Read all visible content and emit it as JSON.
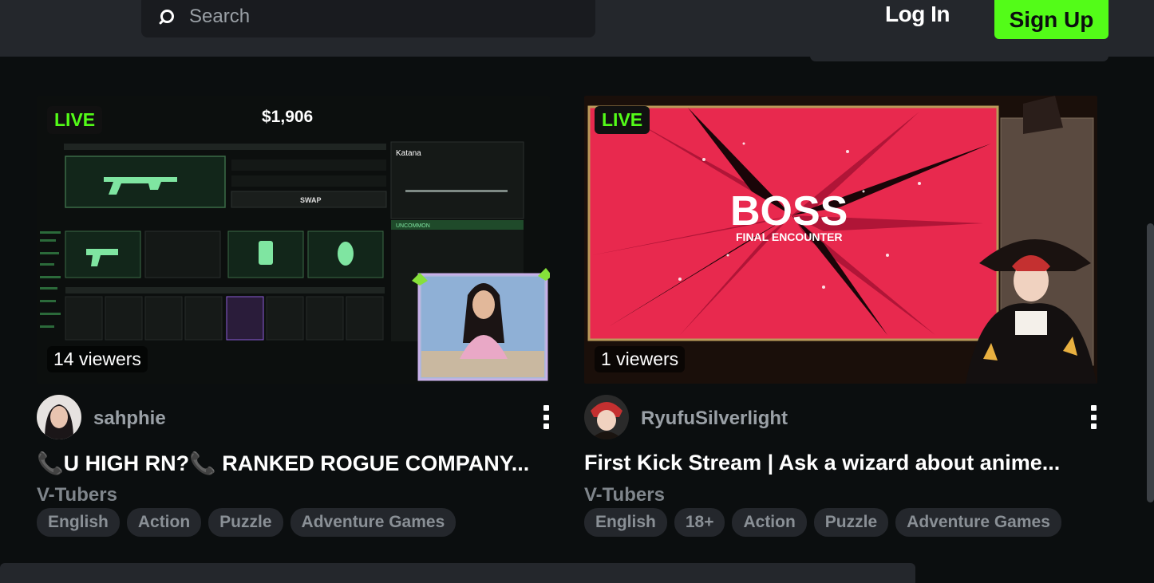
{
  "header": {
    "search_placeholder": "Search",
    "login_label": "Log In",
    "signup_label": "Sign Up",
    "accent_color": "#53fc18"
  },
  "streams": [
    {
      "live_label": "LIVE",
      "viewers": "14 viewers",
      "channel": "sahphie",
      "title": "📞U HIGH RN?📞 RANKED ROGUE COMPANY...",
      "category": "V-Tubers",
      "tags": [
        "English",
        "Action",
        "Puzzle",
        "Adventure Games"
      ],
      "thumbnail_text": {
        "price": "$1,906",
        "item": "Katana",
        "rarity": "UNCOMMON",
        "swap": "SWAP"
      }
    },
    {
      "live_label": "LIVE",
      "viewers": "1 viewers",
      "channel": "RyufuSilverlight",
      "title": "First Kick Stream | Ask a wizard about anime...",
      "category": "V-Tubers",
      "tags": [
        "English",
        "18+",
        "Action",
        "Puzzle",
        "Adventure Games"
      ],
      "thumbnail_text": {
        "boss": "BOSS",
        "subtitle": "FINAL ENCOUNTER"
      }
    }
  ]
}
